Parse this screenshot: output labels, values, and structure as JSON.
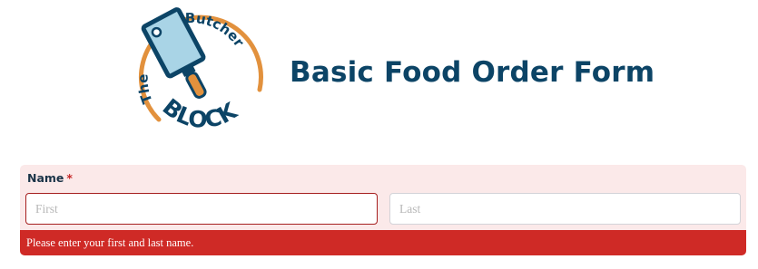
{
  "logo": {
    "text_the": "The",
    "text_butcher": "Butcher",
    "text_block": "BLOCK",
    "colors": {
      "navy": "#0c4466",
      "orange": "#e2913d",
      "steel": "#a9d4e6"
    }
  },
  "header": {
    "title": "Basic Food Order Form"
  },
  "form": {
    "name_field": {
      "label": "Name",
      "required_mark": "*",
      "first": {
        "placeholder": "First",
        "value": ""
      },
      "last": {
        "placeholder": "Last",
        "value": ""
      },
      "error": "Please enter your first and last name."
    }
  },
  "colors": {
    "title": "#0c4466",
    "field_bg": "#fbe9e9",
    "error_bg": "#cf2a26",
    "required": "#c62828"
  }
}
